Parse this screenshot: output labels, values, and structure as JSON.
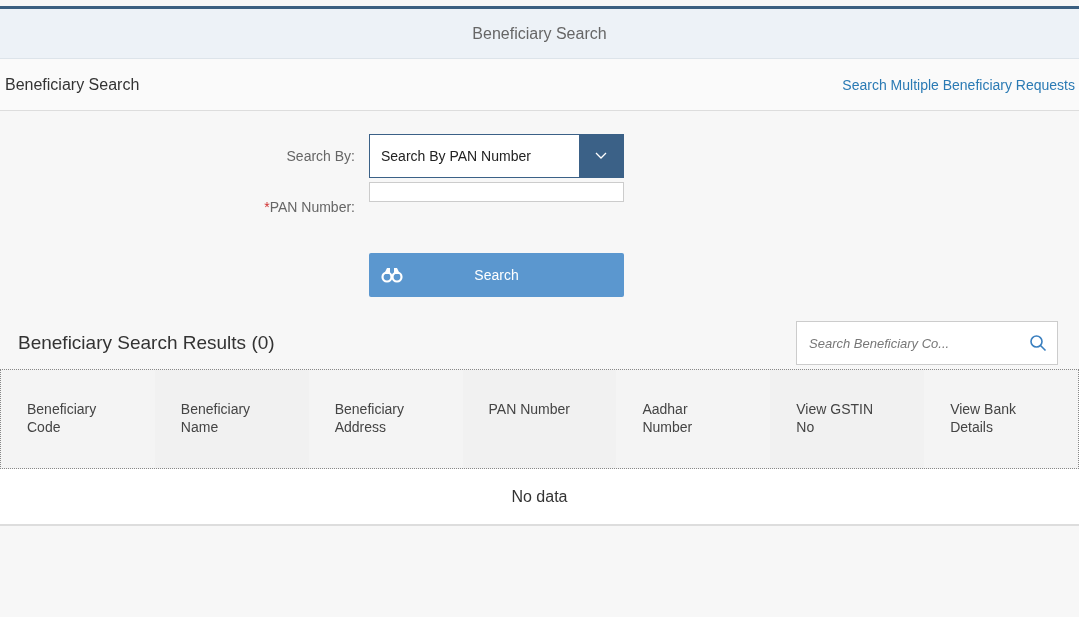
{
  "header": {
    "title": "Beneficiary Search"
  },
  "subheader": {
    "title": "Beneficiary Search",
    "link": "Search Multiple Beneficiary Requests"
  },
  "form": {
    "search_by_label": "Search By:",
    "search_by_value": "Search By PAN Number",
    "pan_label": "PAN Number:",
    "pan_required": true,
    "required_mark": "*",
    "search_button": "Search"
  },
  "results": {
    "title": "Beneficiary Search Results (0)",
    "search_placeholder": "Search Beneficiary Co...",
    "columns": [
      "Beneficiary Code",
      "Beneficiary Name",
      "Beneficiary Address",
      "PAN Number",
      "Aadhar Number",
      "View GSTIN No",
      "View Bank Details"
    ],
    "empty_text": "No data"
  }
}
